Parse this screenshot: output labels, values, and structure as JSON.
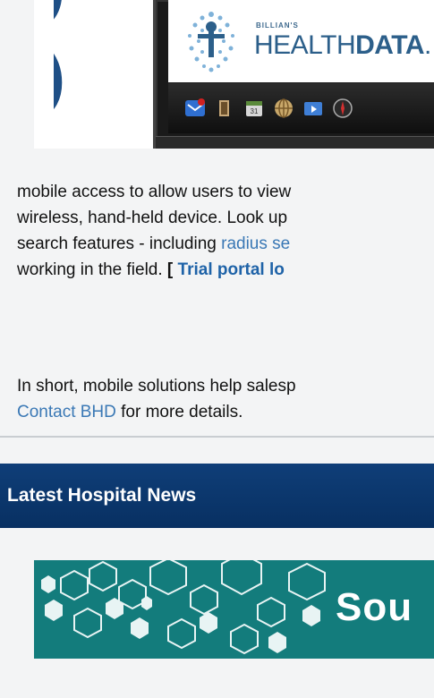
{
  "promo": {
    "go_logo_text": "GO",
    "brand_small": "BILLIAN'S",
    "brand_word_regular": "HEALTH",
    "brand_word_bold": "DATA",
    "brand_suffix": ".",
    "app_icons": [
      "mail-icon",
      "book-icon",
      "calendar-icon",
      "globe-icon",
      "folder-media-icon",
      "compass-icon"
    ]
  },
  "paragraph1": {
    "line1": "mobile access to allow users to view",
    "line2": "wireless, hand-held device.  Look up",
    "line3_text": "search features - including ",
    "line3_link": "radius se",
    "line4_text": "working in the field.   ",
    "line4_bracket": "[ ",
    "line4_link": "Trial portal lo"
  },
  "paragraph2": {
    "line1": "In short, mobile solutions help salesp",
    "line2_link": "Contact BHD",
    "line2_text": " for more details."
  },
  "news": {
    "title": "Latest Hospital News"
  },
  "banner": {
    "text": "Sou"
  },
  "colors": {
    "link": "#3a78b5",
    "header_bg": "#0f3e78",
    "banner_bg": "#137c7c",
    "page_bg": "#f3f4f5"
  }
}
